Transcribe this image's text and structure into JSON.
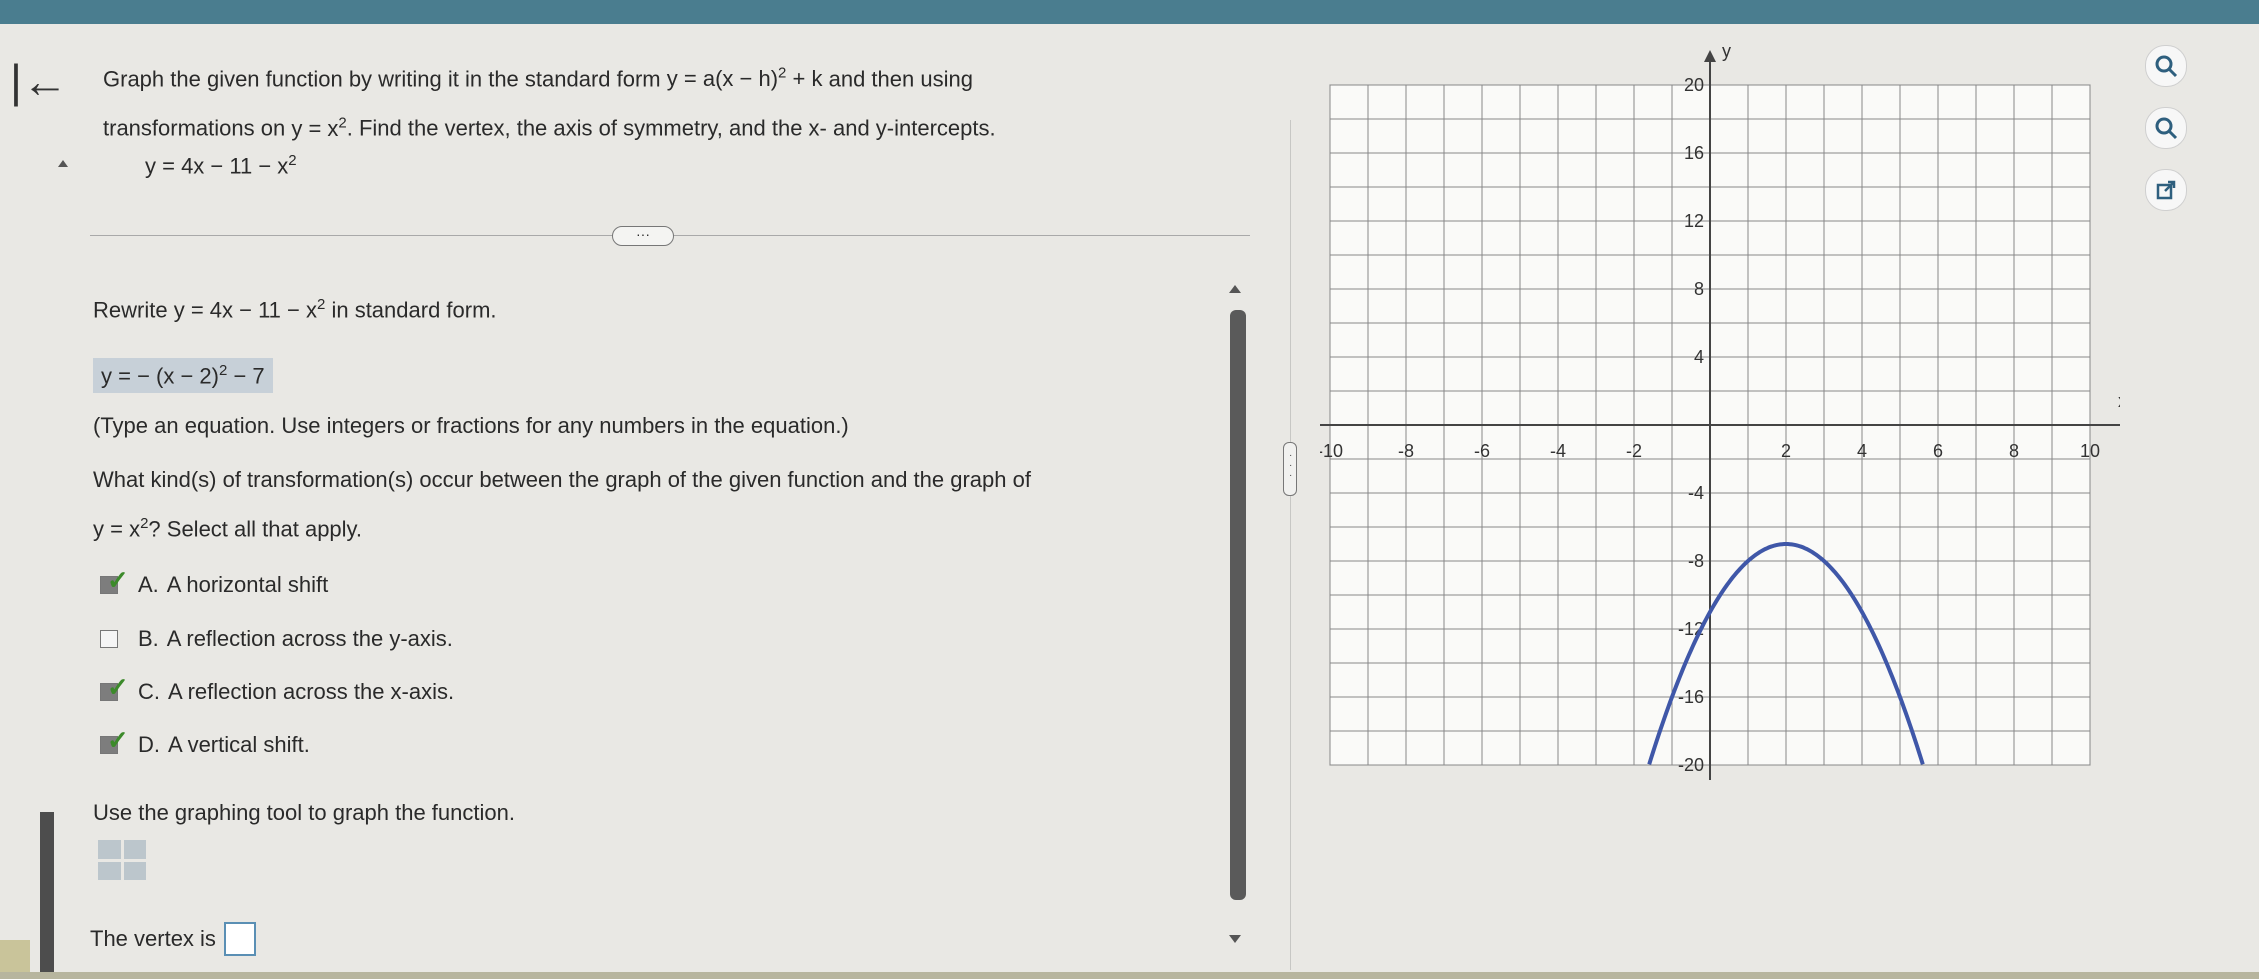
{
  "nav": {
    "back_glyph": "|←"
  },
  "problem": {
    "prompt_line1": "Graph the given function by writing it in the standard form",
    "standard_form": "y = a(x − h)",
    "standard_form_tail": " + k",
    "prompt_line1_end": " and then using",
    "prompt_line2_start": "transformations on",
    "parent": "y = x",
    "prompt_line2_end": ". Find the vertex, the axis of symmetry, and the x- and y-intercepts.",
    "given_equation": "y = 4x − 11 − x",
    "more_label": "···"
  },
  "step1": {
    "question_start": "Rewrite",
    "question_eq": "y = 4x − 11 − x",
    "question_end": " in standard form.",
    "answer": "y = − (x − 2)",
    "answer_tail": " − 7",
    "hint": "(Type an equation. Use integers or fractions for any numbers in the equation.)"
  },
  "step2": {
    "question_line1": "What kind(s) of transformation(s) occur between the graph of the given function and the graph of",
    "question_eq": "y = x",
    "question_end": "? Select all that apply.",
    "options": [
      {
        "letter": "A.",
        "text": "A horizontal shift",
        "checked": true
      },
      {
        "letter": "B.",
        "text": "A reflection across the y-axis.",
        "checked": false
      },
      {
        "letter": "C.",
        "text": "A reflection across the x-axis.",
        "checked": true
      },
      {
        "letter": "D.",
        "text": "A vertical shift.",
        "checked": true
      }
    ]
  },
  "step3": {
    "question": "Use the graphing tool to graph the function.",
    "vertex_label": "The vertex is"
  },
  "graph": {
    "x_label": "x",
    "y_label": "y",
    "xlim": [
      -10,
      10
    ],
    "ylim": [
      -20,
      20
    ],
    "x_ticks": [
      "-10",
      "-8",
      "-6",
      "-4",
      "-2",
      "2",
      "4",
      "6",
      "8",
      "10"
    ],
    "y_ticks": [
      "20",
      "16",
      "12",
      "8",
      "4",
      "-4",
      "-8",
      "-12",
      "-16",
      "-20"
    ],
    "curve_color": "#3f57a8",
    "function": "y = -(x - 2)^2 - 7"
  },
  "tools": [
    "zoom-in-icon",
    "zoom-out-icon",
    "popout-icon"
  ]
}
